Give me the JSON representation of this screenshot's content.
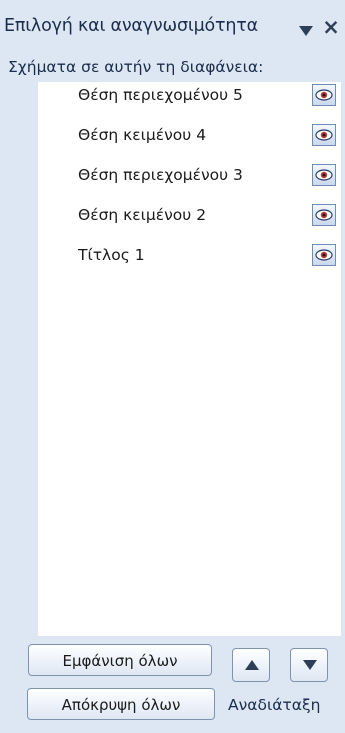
{
  "pane": {
    "title": "Επιλογή και αναγνωσιμότητα",
    "close_glyph": "×",
    "dropdown_icon": "triangle-down-icon"
  },
  "section": {
    "label": "Σχήματα σε αυτήν τη διαφάνεια:"
  },
  "shapes": [
    {
      "label": "Θέση περιεχομένου 5",
      "visible": true,
      "icon": "eye-icon"
    },
    {
      "label": "Θέση κειμένου 4",
      "visible": true,
      "icon": "eye-icon"
    },
    {
      "label": "Θέση περιεχομένου 3",
      "visible": true,
      "icon": "eye-icon"
    },
    {
      "label": "Θέση κειμένου 2",
      "visible": true,
      "icon": "eye-icon"
    },
    {
      "label": "Τίτλος 1",
      "visible": true,
      "icon": "eye-icon"
    }
  ],
  "footer": {
    "show_all": "Εμφάνιση όλων",
    "hide_all": "Απόκρυψη όλων",
    "reorder_label": "Αναδιάταξη",
    "up_icon": "arrow-up-icon",
    "down_icon": "arrow-down-icon"
  },
  "colors": {
    "pane_background": "#dde7f3",
    "list_background": "#ffffff",
    "button_border": "#7f93b1"
  }
}
